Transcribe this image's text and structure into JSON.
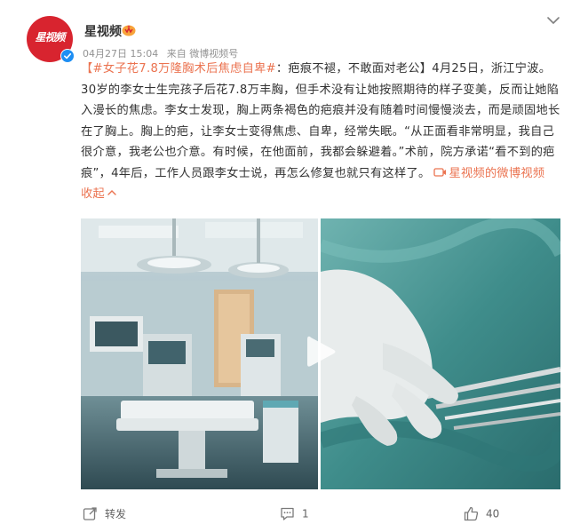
{
  "post": {
    "username": "星视频",
    "date": "04月27日 15:04",
    "source": "来自 微博视频号",
    "topic": "【#女子花7.8万隆胸术后焦虑自卑#",
    "text_1": "：疤痕不褪，不敢面对老公】4月25日，浙江宁波。30岁的李女士生完孩子后花7.8万丰胸，但手术没有让她按照期待的样子变美，反而让她陷入漫长的焦虑。李女士发现，胸上两条褐色的疤痕并没有随着时间慢慢淡去，而是顽固地长在了胸上。胸上的疤，让李女士变得焦虑、自卑，经常失眠。“从正面看非常明显，我自己很介意，我老公也介意。有时候，在他面前，我都会躲避着。”术前，院方承诺“看不到的疤痕”，4年后，工作人员跟李女士说，再怎么修复也就只有这样了。",
    "video_link": "星视频的微博视频",
    "collapse": "收起",
    "avatar_text": "星视频"
  },
  "actions": {
    "repost": "转发",
    "comment": "1",
    "like": "40"
  },
  "colors": {
    "accent": "#eb7350",
    "avatar_bg": "#d8242f",
    "verified": "#1d8ef3",
    "text": "#333333",
    "meta": "#939393"
  },
  "icons": {
    "menu": "chevron-down-icon",
    "play": "play-icon",
    "repost": "share-icon",
    "comment": "comment-icon",
    "like": "thumb-up-icon",
    "video_link": "video-link-icon"
  }
}
